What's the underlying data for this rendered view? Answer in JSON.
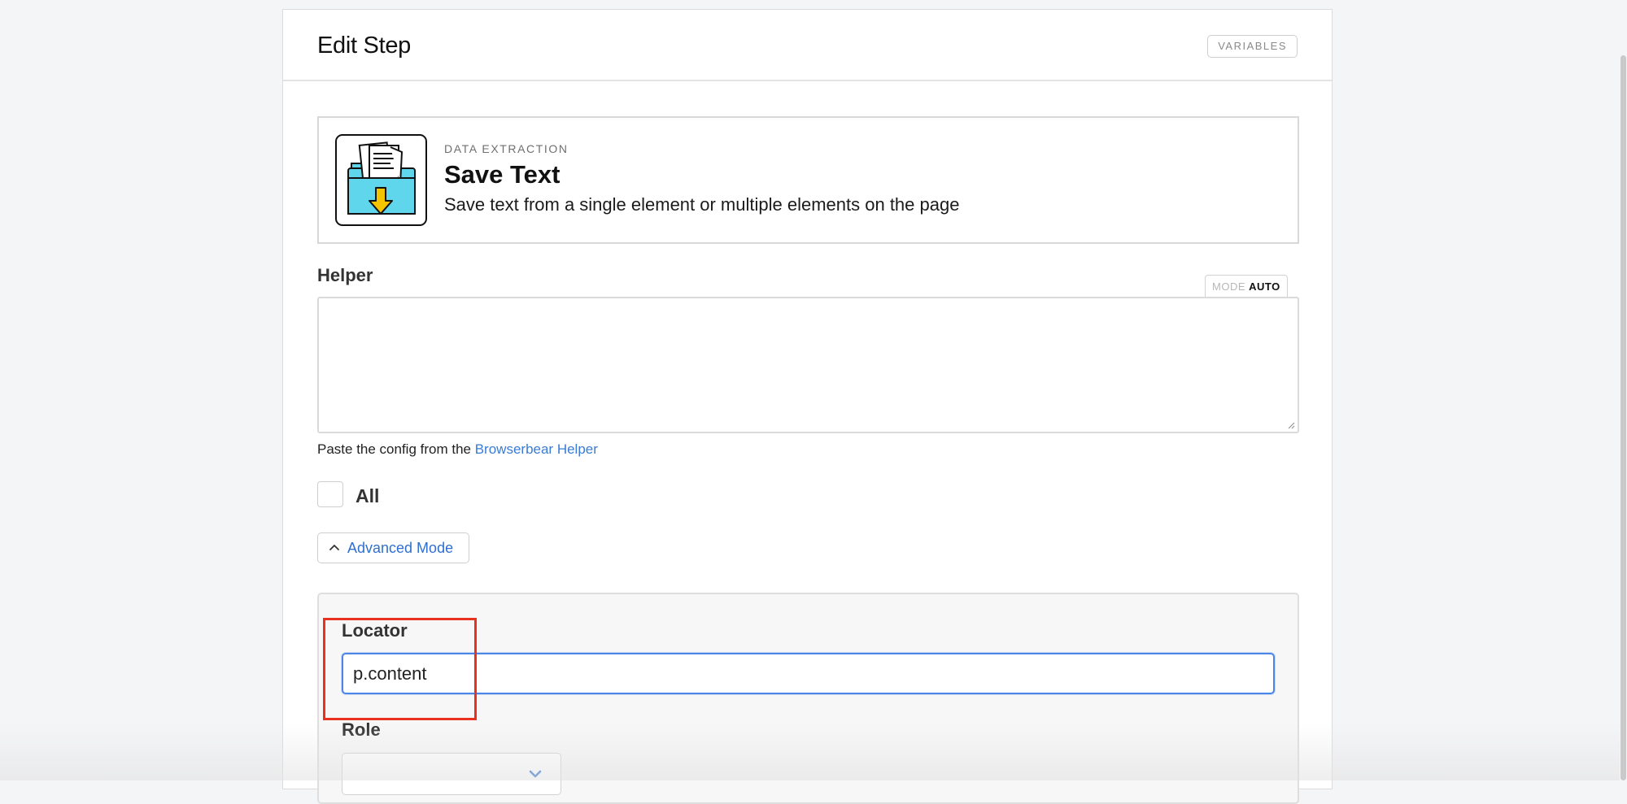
{
  "header": {
    "title": "Edit Step",
    "variables_label": "VARIABLES"
  },
  "action": {
    "category": "DATA EXTRACTION",
    "title": "Save Text",
    "description": "Save text from a single element or multiple elements on the page",
    "icon": "folder-download-icon",
    "icon_colors": {
      "folder": "#5fd6ec",
      "arrow": "#f5c400"
    }
  },
  "helper": {
    "label": "Helper",
    "mode_label": "MODE",
    "mode_value": "AUTO",
    "value": "",
    "hint_text": "Paste the config from the ",
    "hint_link": "Browserbear Helper"
  },
  "all_checkbox": {
    "label": "All",
    "checked": false
  },
  "advanced": {
    "toggle_label": "Advanced Mode",
    "locator_label": "Locator",
    "locator_value": "p.content",
    "role_label": "Role",
    "role_value": ""
  },
  "colors": {
    "accent": "#3a7bd5",
    "highlight": "#e8321f"
  }
}
